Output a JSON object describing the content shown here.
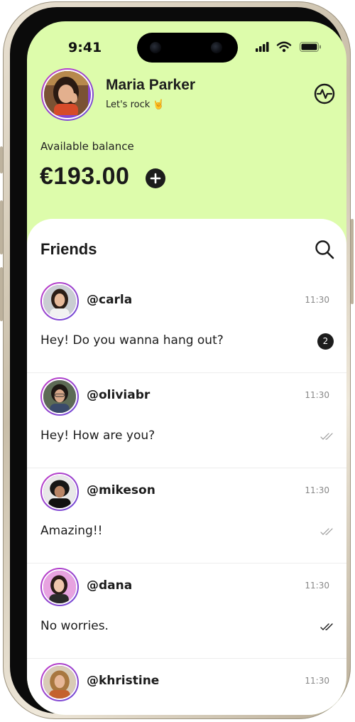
{
  "status_bar": {
    "time": "9:41"
  },
  "profile": {
    "name": "Maria Parker",
    "status": "Let's rock 🤘"
  },
  "balance": {
    "label": "Available balance",
    "amount": "€193.00"
  },
  "friends": {
    "title": "Friends",
    "list": [
      {
        "handle": "@carla",
        "time": "11:30",
        "message": "Hey! Do you wanna hang out?",
        "unread": "2",
        "read_state": "unread"
      },
      {
        "handle": "@oliviabr",
        "time": "11:30",
        "message": "Hey! How are you?",
        "read_state": "delivered"
      },
      {
        "handle": "@mikeson",
        "time": "11:30",
        "message": "Amazing!!",
        "read_state": "delivered"
      },
      {
        "handle": "@dana",
        "time": "11:30",
        "message": "No worries.",
        "read_state": "read"
      },
      {
        "handle": "@khristine",
        "time": "11:30",
        "message": ""
      }
    ]
  },
  "colors": {
    "header_bg": "#ddfcab",
    "avatar_ring": "#c43cc8",
    "dark": "#1c1c1c"
  },
  "icons": [
    "activity-icon",
    "plus-icon",
    "search-icon",
    "double-check-icon",
    "signal-icon",
    "wifi-icon",
    "battery-icon"
  ]
}
